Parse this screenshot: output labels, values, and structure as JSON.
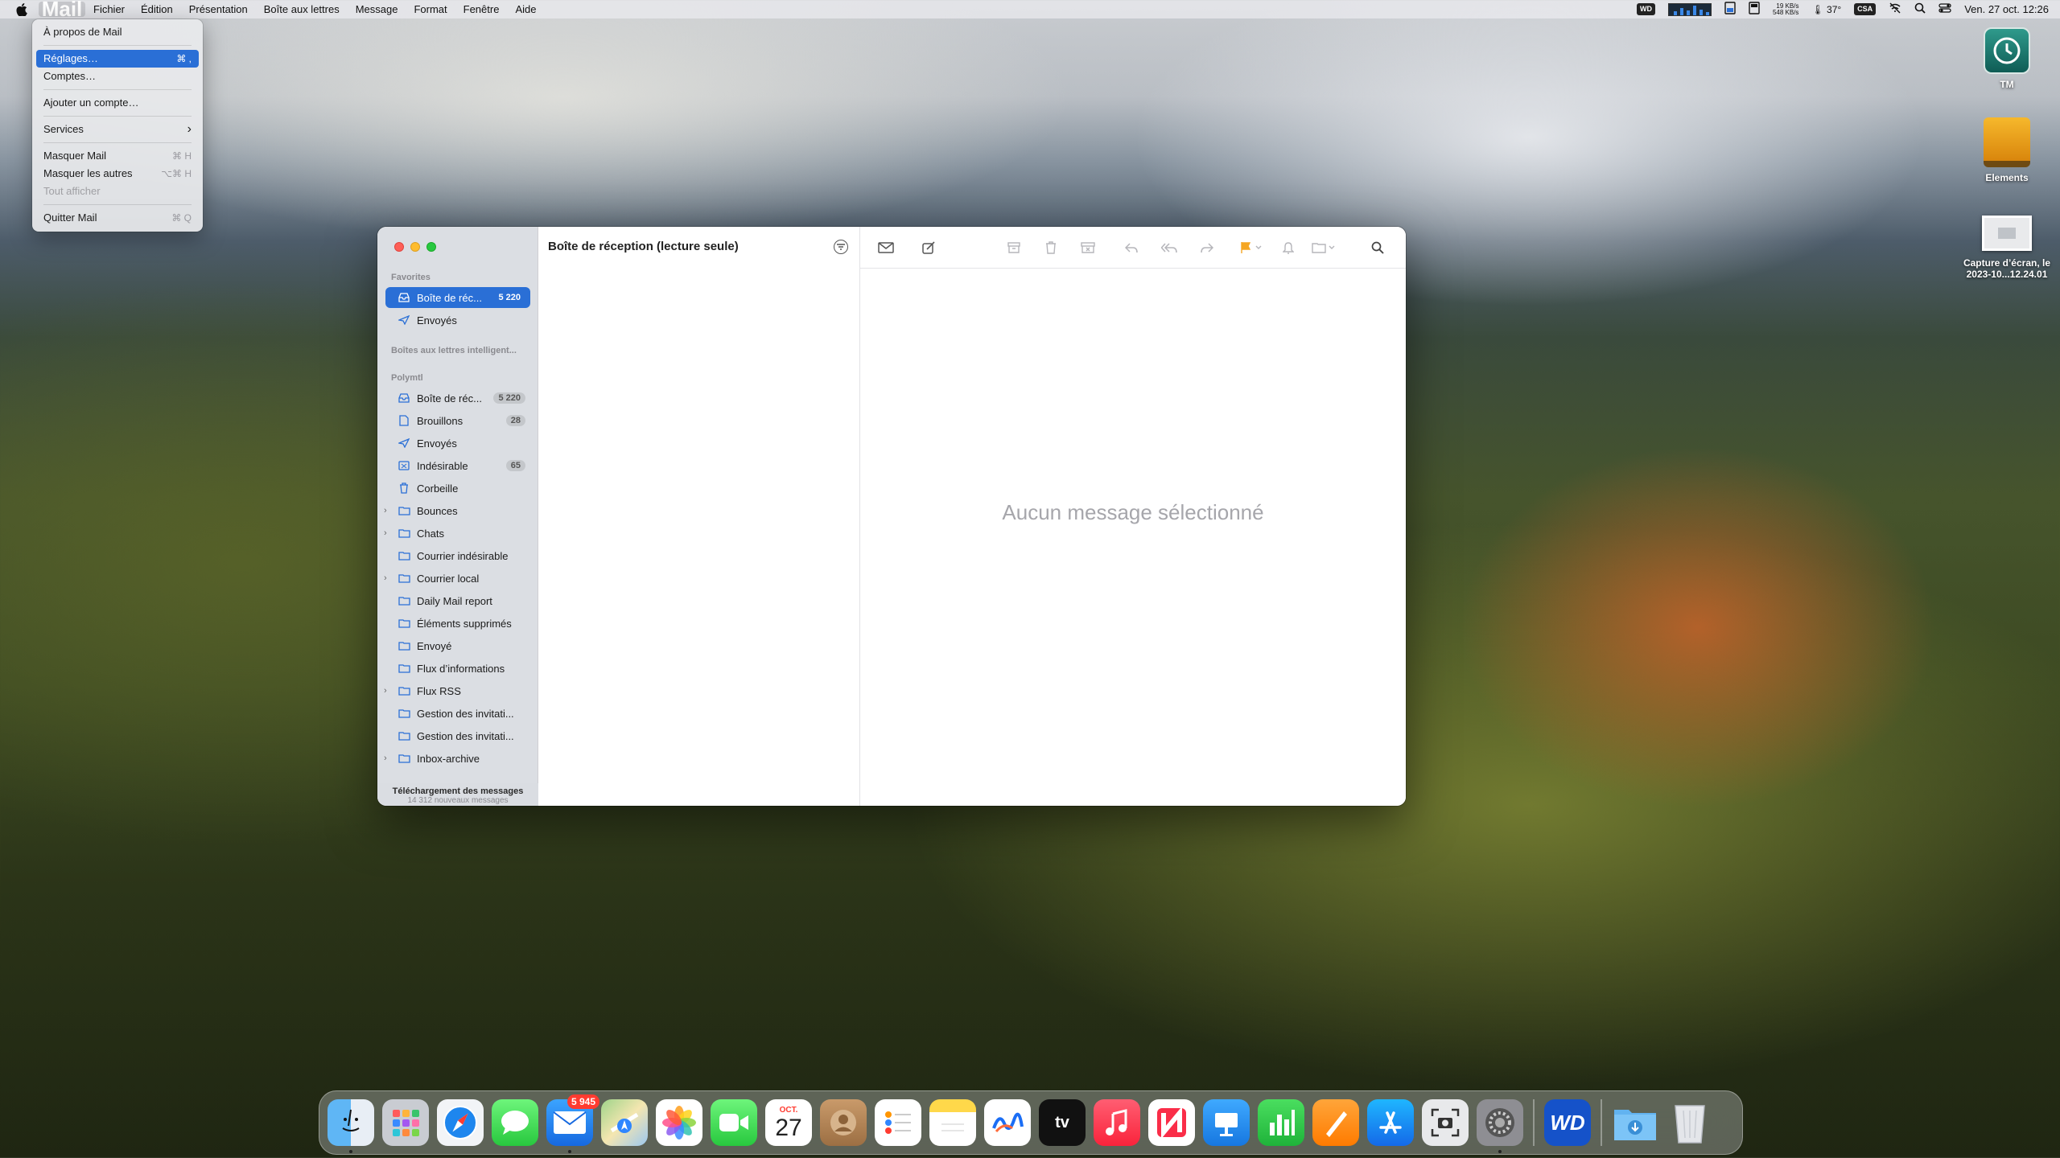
{
  "menubar": {
    "app_name": "Mail",
    "menus": [
      "Fichier",
      "Édition",
      "Présentation",
      "Boîte aux lettres",
      "Message",
      "Format",
      "Fenêtre",
      "Aide"
    ],
    "status": {
      "wd": "WD",
      "net_up": "19 KB/s",
      "net_down": "548 KB/s",
      "temp": "37°",
      "csa": "CSA",
      "clock": "Ven. 27 oct. 12:26"
    }
  },
  "dropdown": {
    "items": [
      {
        "label": "À propos de Mail",
        "shortcut": ""
      },
      {
        "label": "Réglages…",
        "shortcut": "⌘ ,"
      },
      {
        "label": "Comptes…",
        "shortcut": ""
      },
      {
        "label": "Ajouter un compte…",
        "shortcut": ""
      },
      {
        "label": "Services",
        "shortcut": "›"
      },
      {
        "label": "Masquer Mail",
        "shortcut": "⌘ H"
      },
      {
        "label": "Masquer les autres",
        "shortcut": "⌥⌘ H"
      },
      {
        "label": "Tout afficher",
        "shortcut": ""
      },
      {
        "label": "Quitter Mail",
        "shortcut": "⌘ Q"
      }
    ]
  },
  "desktop": {
    "icons": [
      {
        "label": "TM"
      },
      {
        "label": "Elements"
      },
      {
        "label": "Capture d’écran, le 2023-10...12.24.01"
      }
    ]
  },
  "mail": {
    "sidebar": {
      "section_favorites": "Favorites",
      "fav_items": [
        {
          "label": "Boîte de réc...",
          "count": "5 220"
        },
        {
          "label": "Envoyés",
          "count": ""
        }
      ],
      "section_smart": "Boîtes aux lettres intelligent...",
      "section_account": "Polymtl",
      "account_items": [
        {
          "label": "Boîte de réc...",
          "count": "5 220"
        },
        {
          "label": "Brouillons",
          "count": "28"
        },
        {
          "label": "Envoyés",
          "count": ""
        },
        {
          "label": "Indésirable",
          "count": "65"
        },
        {
          "label": "Corbeille",
          "count": ""
        },
        {
          "label": "Bounces",
          "count": ""
        },
        {
          "label": "Chats",
          "count": ""
        },
        {
          "label": "Courrier indésirable",
          "count": ""
        },
        {
          "label": "Courrier local",
          "count": ""
        },
        {
          "label": "Daily Mail report",
          "count": ""
        },
        {
          "label": "Éléments supprimés",
          "count": ""
        },
        {
          "label": "Envoyé",
          "count": ""
        },
        {
          "label": "Flux d’informations",
          "count": ""
        },
        {
          "label": "Flux RSS",
          "count": ""
        },
        {
          "label": "Gestion des invitati...",
          "count": ""
        },
        {
          "label": "Gestion des invitati...",
          "count": ""
        },
        {
          "label": "Inbox-archive",
          "count": ""
        }
      ],
      "footer_title": "Téléchargement des messages",
      "footer_sub": "14 312 nouveaux messages"
    },
    "list_title": "Boîte de réception (lecture seule)",
    "empty_text": "Aucun message sélectionné"
  },
  "dock": {
    "mail_badge": "5 945",
    "calendar_month": "OCT.",
    "calendar_day": "27",
    "tv_label": "tv",
    "wd_label": "WD"
  },
  "colors": {
    "accent": "#2a6fd6",
    "flag": "#f5a623"
  }
}
